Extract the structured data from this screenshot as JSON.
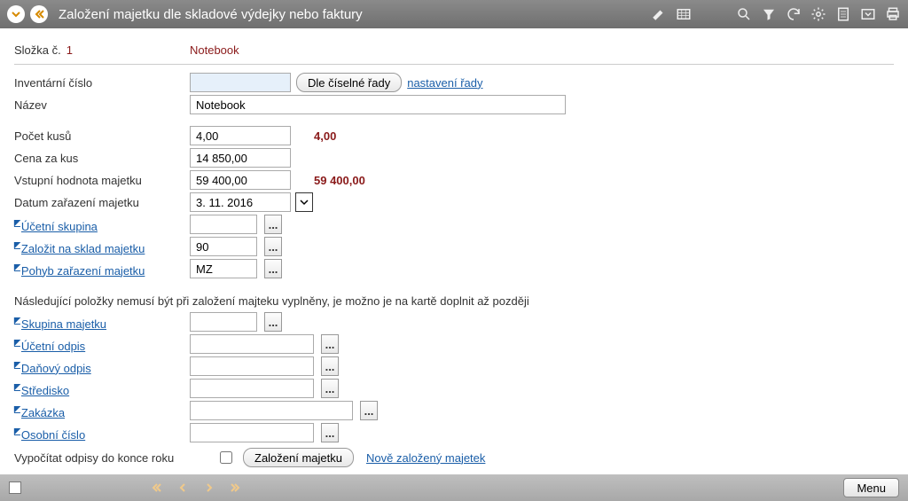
{
  "header": {
    "title": "Založení majetku dle skladové výdejky nebo faktury"
  },
  "folder": {
    "label": "Složka č.",
    "number": "1",
    "name": "Notebook"
  },
  "fields": {
    "inventory_label": "Inventární číslo",
    "inventory_value": "",
    "series_btn": "Dle číselné řady",
    "series_link": "nastavení řady",
    "name_label": "Název",
    "name_value": "Notebook",
    "qty_label": "Počet kusů",
    "qty_value": "4,00",
    "qty_annot": "4,00",
    "price_label": "Cena za kus",
    "price_value": "14 850,00",
    "inval_label": "Vstupní hodnota majetku",
    "inval_value": "59 400,00",
    "inval_annot": "59 400,00",
    "date_label": "Datum zařazení majetku",
    "date_value": "3. 11. 2016",
    "acct_group_label": "Účetní skupina",
    "acct_group_value": "",
    "stock_label": "Založit na sklad majetku",
    "stock_value": "90",
    "move_label": "Pohyb zařazení majetku",
    "move_value": "MZ"
  },
  "note": "Následující položky nemusí být při založení majteku vyplněny, je možno je na kartě doplnit až později",
  "extras": {
    "group_label": "Skupina majetku",
    "group_value": "",
    "acct_dep_label": "Účetní odpis",
    "acct_dep_value": "",
    "tax_dep_label": "Daňový odpis",
    "tax_dep_value": "",
    "center_label": "Středisko",
    "center_value": "",
    "order_label": "Zakázka",
    "order_value": "",
    "person_label": "Osobní číslo",
    "person_value": ""
  },
  "footer_row": {
    "calc_label": "Vypočítat odpisy do konce roku",
    "create_btn": "Založení majetku",
    "new_link": "Nově založený majetek"
  },
  "menu": "Menu"
}
